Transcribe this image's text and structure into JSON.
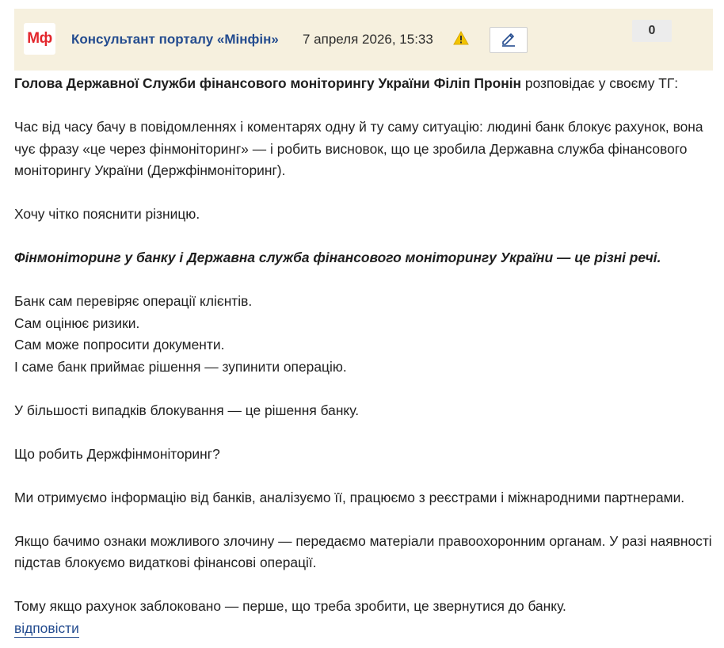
{
  "comment": {
    "logo_text": "Мф",
    "author": "Консультант порталу «Мінфін»",
    "date": "7 апреля 2026, 15:33",
    "score": "0",
    "icons": {
      "warning": "warning-icon",
      "edit": "pencil-icon"
    },
    "colors": {
      "header_bg": "#f6f0de",
      "author_link": "#244c8f",
      "logo_red": "#e3262c",
      "warning_yellow": "#f2c400"
    },
    "intro_bold": "Голова Державної Служби фінансового моніторингу України Філіп Пронін",
    "intro_rest": " розповідає у своєму ТГ:",
    "p1": "Час від часу бачу в повідомленнях і коментарях одну й ту саму ситуацію: людині банк блокує рахунок, вона чує фразу «це через фінмоніторинг» — і робить висновок, що це зробила Державна служба фінансового моніторингу України (Держфінмоніторинг).",
    "p2": "Хочу чітко пояснити різницю.",
    "p3_emphasis": "Фінмоніторинг у банку і Державна служба фінансового моніторингу України — це різні речі.",
    "bank_lines": [
      "Банк сам перевіряє операції клієнтів.",
      "Сам оцінює ризики.",
      "Сам може попросити документи.",
      "І саме банк приймає рішення — зупинити операцію."
    ],
    "p5": "У більшості випадків блокування — це рішення банку.",
    "p6": "Що робить Держфінмоніторинг?",
    "p7": "Ми отримуємо інформацію від банків, аналізуємо її, працюємо з реєстрами і міжнародними партнерами.",
    "p8": "Якщо бачимо ознаки можливого злочину — передаємо матеріали правоохоронним органам. У разі наявності підстав блокуємо видаткові фінансові операції.",
    "p9": "Тому якщо рахунок заблоковано — перше, що треба зробити, це звернутися до банку.",
    "reply_label": "відповісти"
  }
}
